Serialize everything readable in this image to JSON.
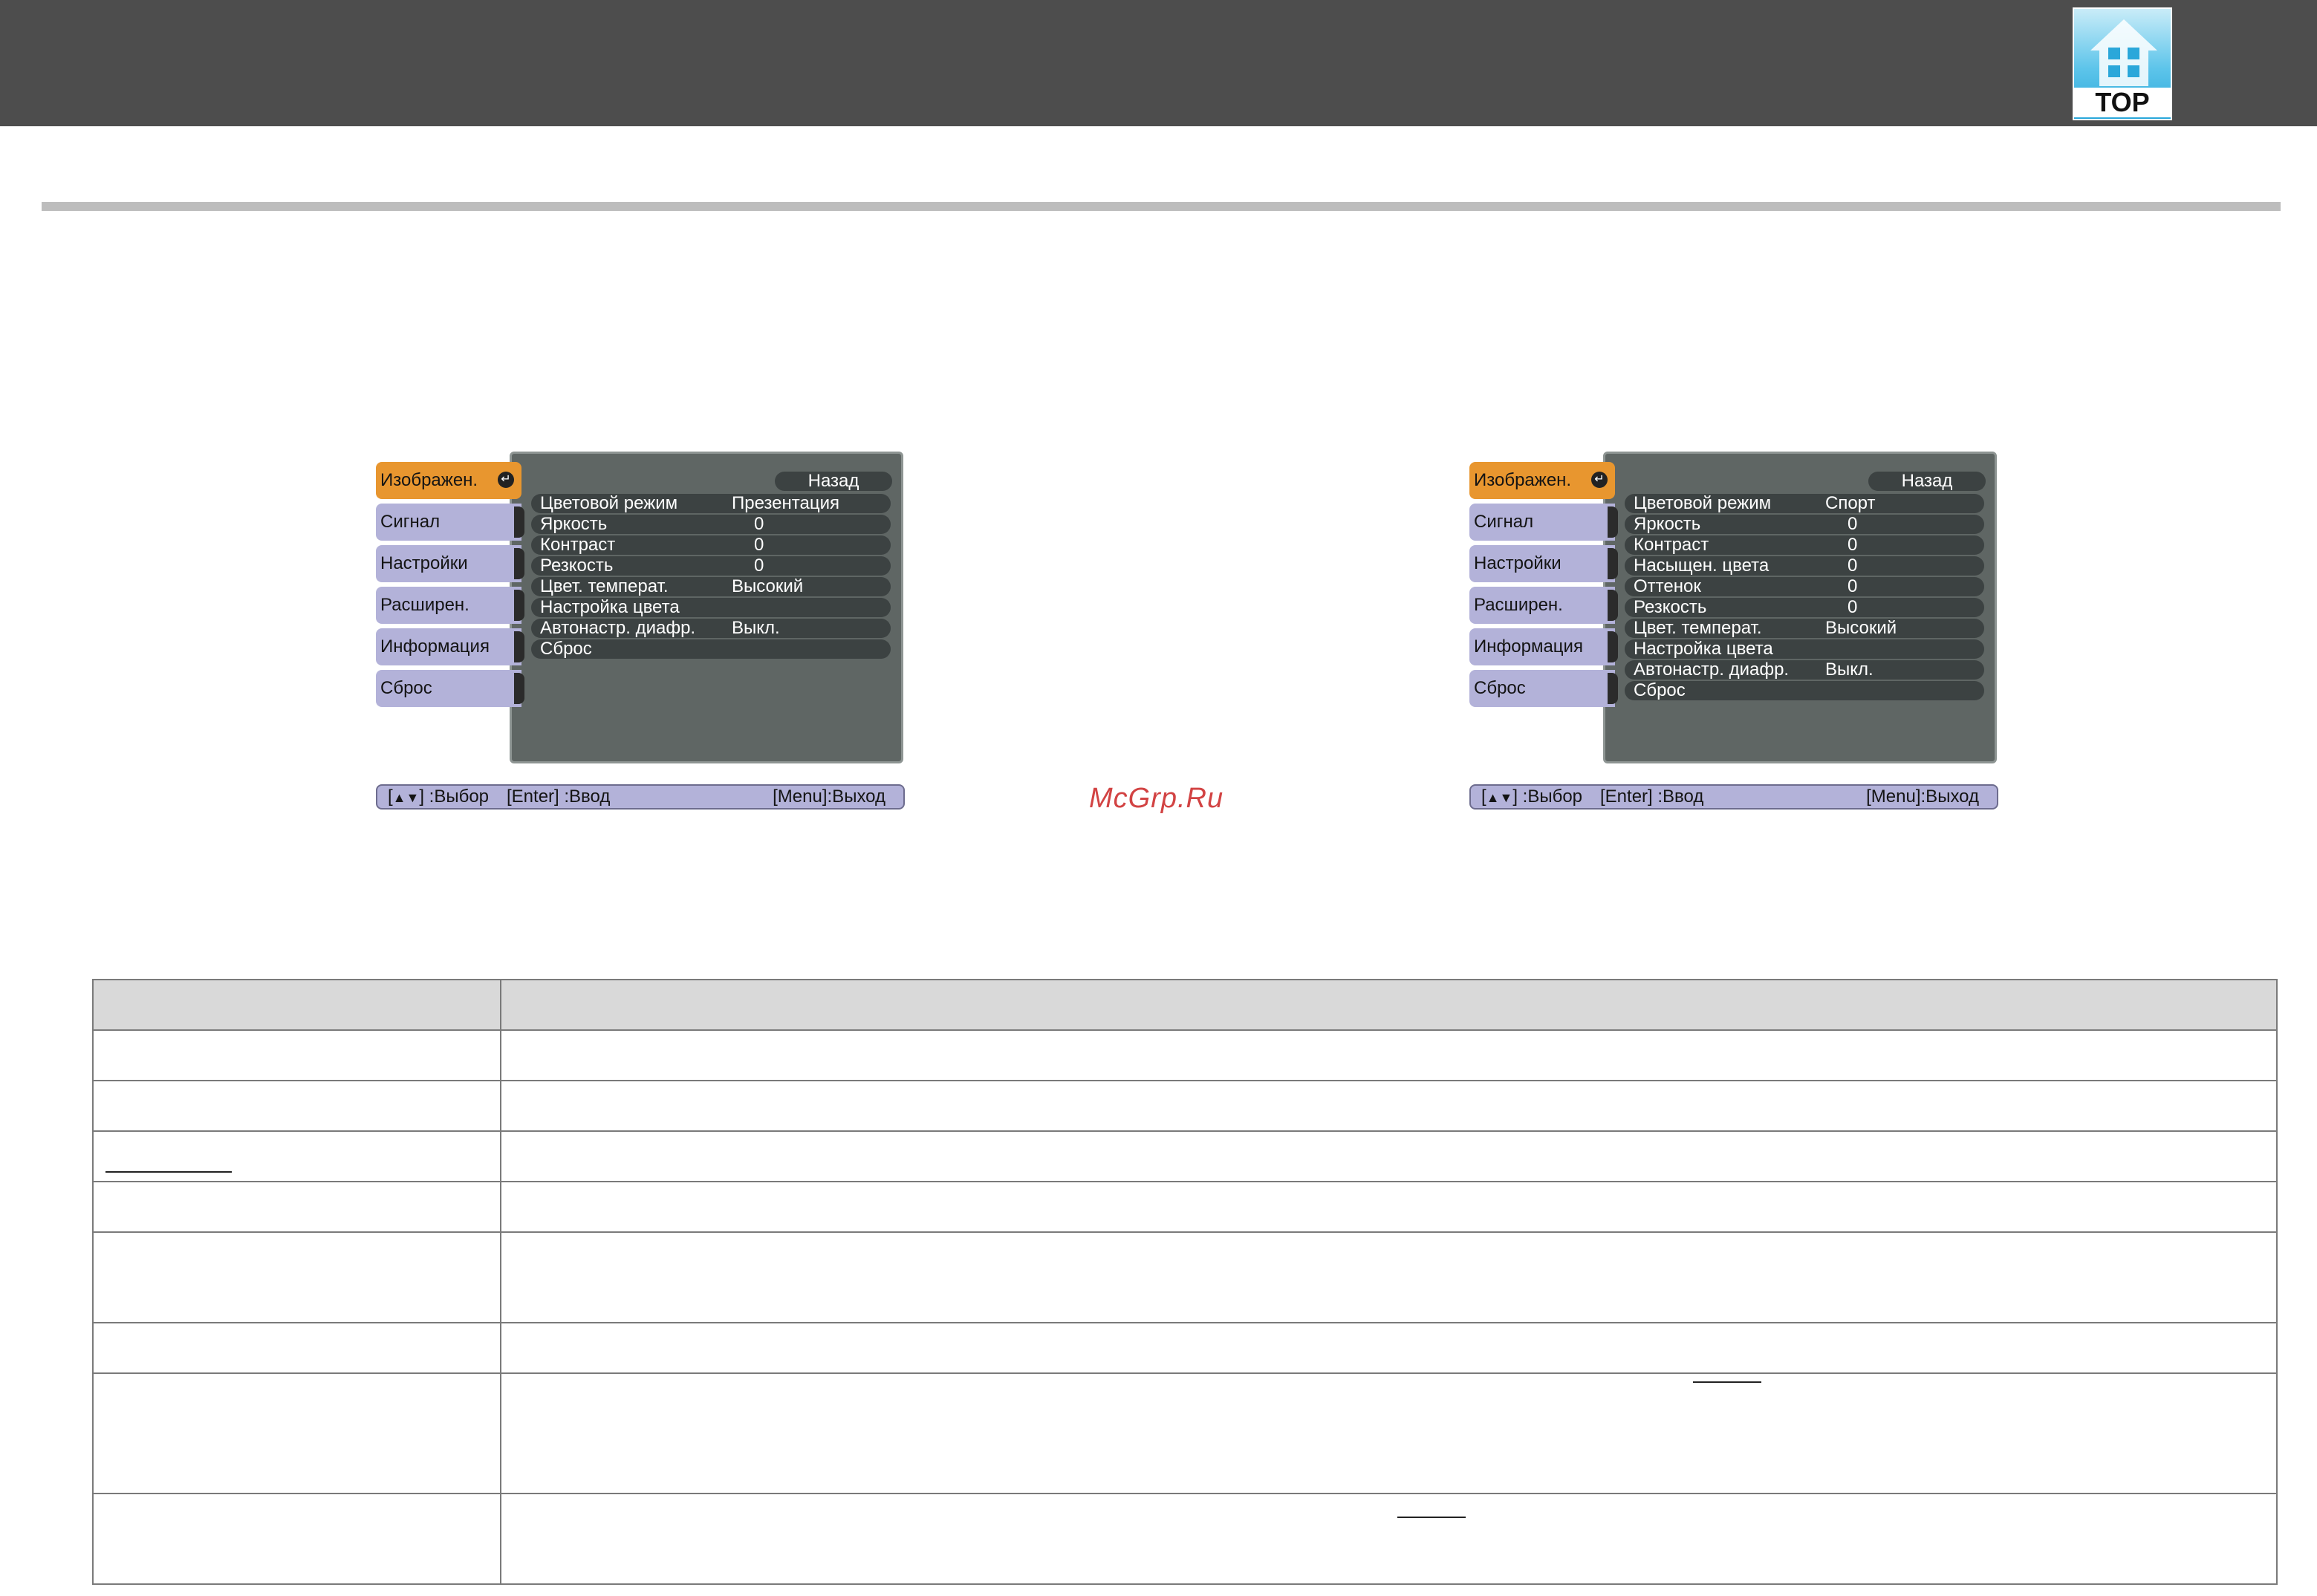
{
  "header": {
    "logo_text": "TOP"
  },
  "watermark": "McGrp.Ru",
  "menus": [
    {
      "tabs": [
        "Изображен.",
        "Сигнал",
        "Настройки",
        "Расширен.",
        "Информация",
        "Сброс"
      ],
      "back_label": "Назад",
      "rows": [
        {
          "label": "Цветовой режим",
          "value": "Презентация"
        },
        {
          "label": "Яркость",
          "value": "0"
        },
        {
          "label": "Контраст",
          "value": "0"
        },
        {
          "label": "Резкость",
          "value": "0"
        },
        {
          "label": "Цвет. температ.",
          "value": "Высокий"
        },
        {
          "label": "Настройка цвета",
          "value": ""
        },
        {
          "label": "Автонастр. диафр.",
          "value": "Выкл."
        },
        {
          "label": "Сброс",
          "value": ""
        }
      ],
      "help": {
        "nav": ":Выбор",
        "enter": "[Enter] :Ввод",
        "menu": "[Menu]:Выход"
      }
    },
    {
      "tabs": [
        "Изображен.",
        "Сигнал",
        "Настройки",
        "Расширен.",
        "Информация",
        "Сброс"
      ],
      "back_label": "Назад",
      "rows": [
        {
          "label": "Цветовой режим",
          "value": "Спорт"
        },
        {
          "label": "Яркость",
          "value": "0"
        },
        {
          "label": "Контраст",
          "value": "0"
        },
        {
          "label": "Насыщен. цвета",
          "value": "0"
        },
        {
          "label": "Оттенок",
          "value": "0"
        },
        {
          "label": "Резкость",
          "value": "0"
        },
        {
          "label": "Цвет. температ.",
          "value": "Высокий"
        },
        {
          "label": "Настройка цвета",
          "value": ""
        },
        {
          "label": "Автонастр. диафр.",
          "value": "Выкл."
        },
        {
          "label": "Сброс",
          "value": ""
        }
      ],
      "help": {
        "nav": ":Выбор",
        "enter": "[Enter] :Ввод",
        "menu": "[Menu]:Выход"
      }
    }
  ]
}
